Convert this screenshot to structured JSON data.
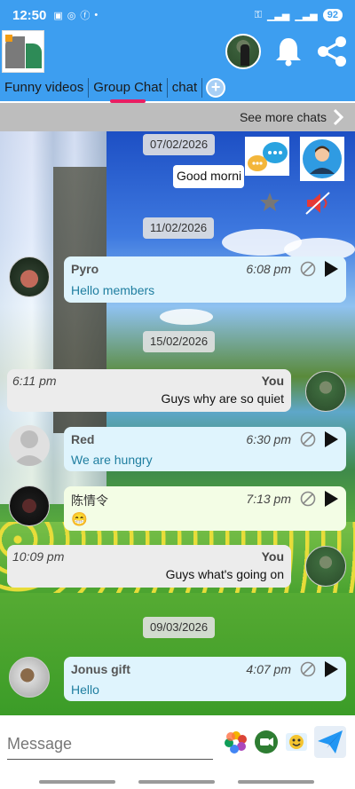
{
  "status_bar": {
    "time": "12:50",
    "battery": "92"
  },
  "header": {
    "tabs": [
      {
        "label": "Funny videos"
      },
      {
        "label": "Group Chat"
      },
      {
        "label": "chat"
      }
    ],
    "add_tab": "+"
  },
  "see_more": {
    "label": "See more chats"
  },
  "messages": [
    {
      "type": "date",
      "text": "07/02/2026"
    },
    {
      "type": "system_partial",
      "text": "Good morni"
    },
    {
      "type": "date",
      "text": "11/02/2026"
    },
    {
      "type": "in",
      "sender": "Pyro",
      "time": "6:08 pm",
      "text": "Hello members"
    },
    {
      "type": "date",
      "text": "15/02/2026"
    },
    {
      "type": "out",
      "label": "You",
      "time": "6:11 pm",
      "text": "Guys why are so quiet"
    },
    {
      "type": "in",
      "sender": "Red",
      "time": "6:30 pm",
      "text": "We are hungry"
    },
    {
      "type": "in",
      "sender": "陈情令",
      "time": "7:13 pm",
      "text": "😁"
    },
    {
      "type": "out",
      "label": "You",
      "time": "10:09 pm",
      "text": "Guys what's going on"
    },
    {
      "type": "date",
      "text": "09/03/2026"
    },
    {
      "type": "in",
      "sender": "Jonus gift",
      "time": "4:07 pm",
      "text": "Hello"
    }
  ],
  "input": {
    "placeholder": "Message"
  },
  "colors": {
    "header": "#3d9ef0",
    "active_tab_indicator": "#e91e63",
    "incoming_bubble": "#dff4fd",
    "outgoing_bubble": "#ececec"
  }
}
